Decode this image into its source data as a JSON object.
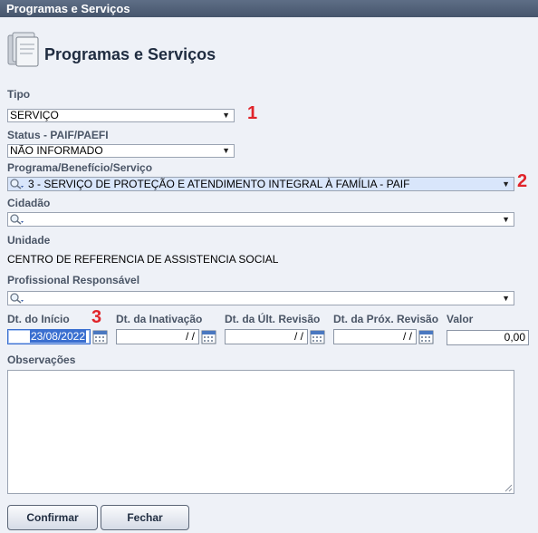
{
  "window": {
    "title": "Programas e Serviços"
  },
  "header": {
    "title": "Programas e Serviços",
    "icon": "document-stack-icon"
  },
  "form": {
    "tipo": {
      "label": "Tipo",
      "value": "SERVIÇO"
    },
    "status": {
      "label": "Status - PAIF/PAEFI",
      "value": "NÃO INFORMADO"
    },
    "programa": {
      "label": "Programa/Benefício/Serviço",
      "value": "3 - SERVIÇO DE PROTEÇÃO E ATENDIMENTO INTEGRAL À FAMÍLIA - PAIF"
    },
    "cidadao": {
      "label": "Cidadão",
      "value": ""
    },
    "unidade": {
      "label": "Unidade",
      "value": "CENTRO DE REFERENCIA DE ASSISTENCIA SOCIAL"
    },
    "profissional": {
      "label": "Profissional Responsável",
      "value": ""
    },
    "dt_inicio": {
      "label": "Dt. do Início",
      "value": "23/08/2022"
    },
    "dt_inativacao": {
      "label": "Dt. da Inativação",
      "value": "/ /"
    },
    "dt_ult_revisao": {
      "label": "Dt. da Últ. Revisão",
      "value": "/ /"
    },
    "dt_prox_revisao": {
      "label": "Dt. da Próx. Revisão",
      "value": "/ /"
    },
    "valor": {
      "label": "Valor",
      "value": "0,00"
    },
    "observacoes": {
      "label": "Observações",
      "value": ""
    }
  },
  "buttons": {
    "confirm": "Confirmar",
    "close": "Fechar"
  },
  "markers": {
    "m1": "1",
    "m2": "2",
    "m3": "3"
  },
  "colors": {
    "marker": "#e0242a",
    "titlebar": "#46556c",
    "background": "#eef1f7"
  }
}
